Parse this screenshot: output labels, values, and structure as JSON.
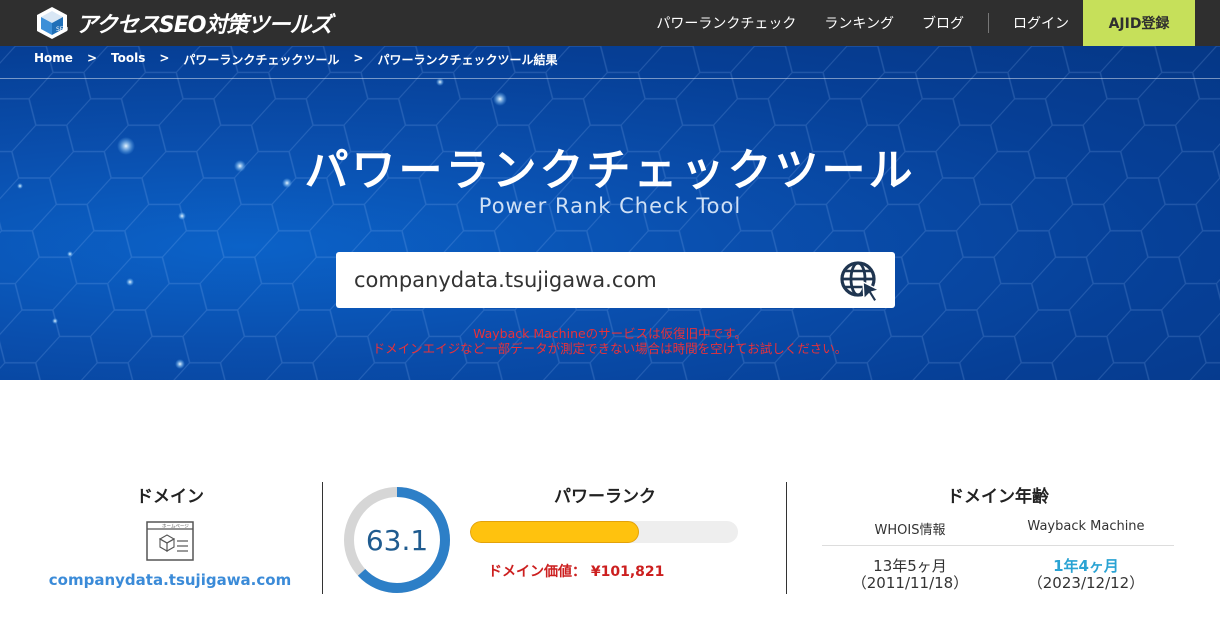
{
  "header": {
    "logo_text": "アクセスSEO対策ツールズ",
    "logo_badge": "SEO",
    "nav": [
      "パワーランクチェック",
      "ランキング",
      "ブログ"
    ],
    "login": "ログイン",
    "register": "AJID登録"
  },
  "breadcrumb": {
    "items": [
      "Home",
      "Tools",
      "パワーランクチェックツール",
      "パワーランクチェックツール結果"
    ],
    "separator": ">"
  },
  "hero": {
    "title": "パワーランクチェックツール",
    "subtitle": "Power Rank Check Tool",
    "search_value": "companydata.tsujigawa.com",
    "search_button_icon": "globe-cursor-icon",
    "notice_line1": "Wayback Machineのサービスは仮復旧中です。",
    "notice_line2": "ドメインエイジなど一部データが測定できない場合は時間を空けてお試しください。"
  },
  "result": {
    "domain": {
      "title": "ドメイン",
      "icon_label": "ホームページ",
      "value": "companydata.tsujigawa.com"
    },
    "power_rank": {
      "title": "パワーランク",
      "score": "63.1",
      "score_fraction": 0.631,
      "bar_fraction": 0.63,
      "value_label": "ドメイン価値：",
      "value": "¥101,821"
    },
    "domain_age": {
      "title": "ドメイン年齢",
      "whois_label": "WHOIS情報",
      "wayback_label": "Wayback Machine",
      "whois_age": "13年5ヶ月",
      "whois_date": "（2011/11/18）",
      "wayback_age": "1年4ヶ月",
      "wayback_date": "（2023/12/12）"
    }
  },
  "colors": {
    "header_bg": "#2f2f2f",
    "register_bg": "#c6e05a",
    "hero_blue": "#0a4fae",
    "gauge_blue": "#2d7fc7",
    "gauge_gray": "#d6d6d6",
    "bar_yellow": "#ffc20e",
    "notice_red": "#e8313a",
    "value_red": "#cc1f1f",
    "link_blue": "#3b8bd8",
    "wayback_blue": "#2aa3d3"
  }
}
